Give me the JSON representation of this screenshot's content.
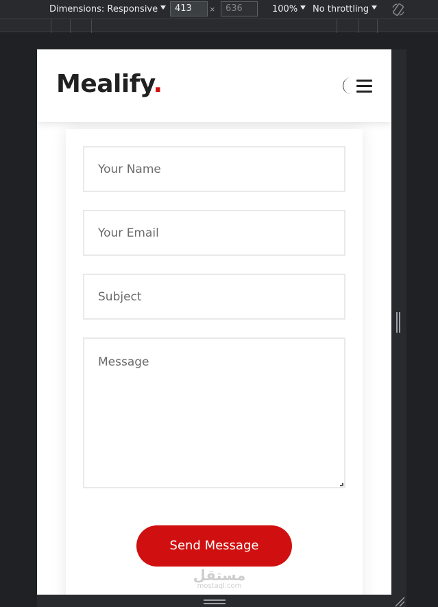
{
  "devtools": {
    "dimensions_label": "Dimensions: Responsive",
    "width_value": "413",
    "height_value": "636",
    "times": "×",
    "zoom": "100%",
    "throttling": "No throttling"
  },
  "site": {
    "logo_text": "Mealify",
    "logo_dot": ".",
    "accent_color": "#d01010",
    "header_icons": [
      "moon-icon",
      "menu-icon"
    ]
  },
  "form": {
    "name_placeholder": "Your Name",
    "email_placeholder": "Your Email",
    "subject_placeholder": "Subject",
    "message_placeholder": "Message",
    "send_label": "Send Message"
  },
  "watermark": {
    "main": "مستقل",
    "sub": "mostaql.com"
  }
}
